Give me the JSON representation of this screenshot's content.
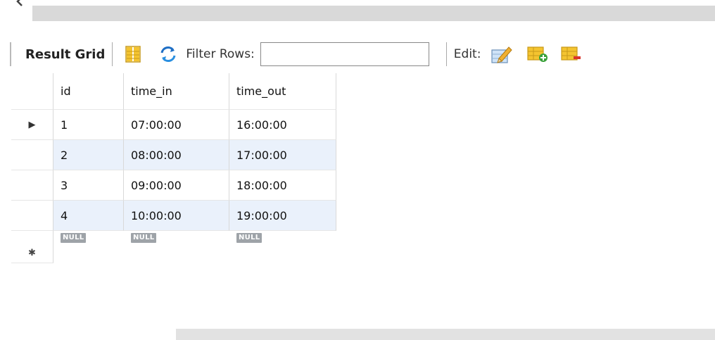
{
  "toolbar": {
    "result_grid_label": "Result Grid",
    "filter_rows_label": "Filter Rows:",
    "filter_rows_value": "",
    "edit_label": "Edit:"
  },
  "grid": {
    "columns": [
      "id",
      "time_in",
      "time_out"
    ],
    "rows": [
      [
        "1",
        "07:00:00",
        "16:00:00"
      ],
      [
        "2",
        "08:00:00",
        "17:00:00"
      ],
      [
        "3",
        "09:00:00",
        "18:00:00"
      ],
      [
        "4",
        "10:00:00",
        "19:00:00"
      ]
    ],
    "new_row_values": [
      "NULL",
      "NULL",
      "NULL"
    ],
    "current_row_marker": "▶",
    "new_row_marker": "✱"
  },
  "icons": {
    "toolbar": [
      "grid-layout-icon",
      "refresh-icon",
      "edit-pencil-icon",
      "add-row-icon",
      "delete-row-icon"
    ]
  },
  "colors": {
    "alt_row": "#eaf1fb",
    "null_badge": "#9ea3a8"
  }
}
